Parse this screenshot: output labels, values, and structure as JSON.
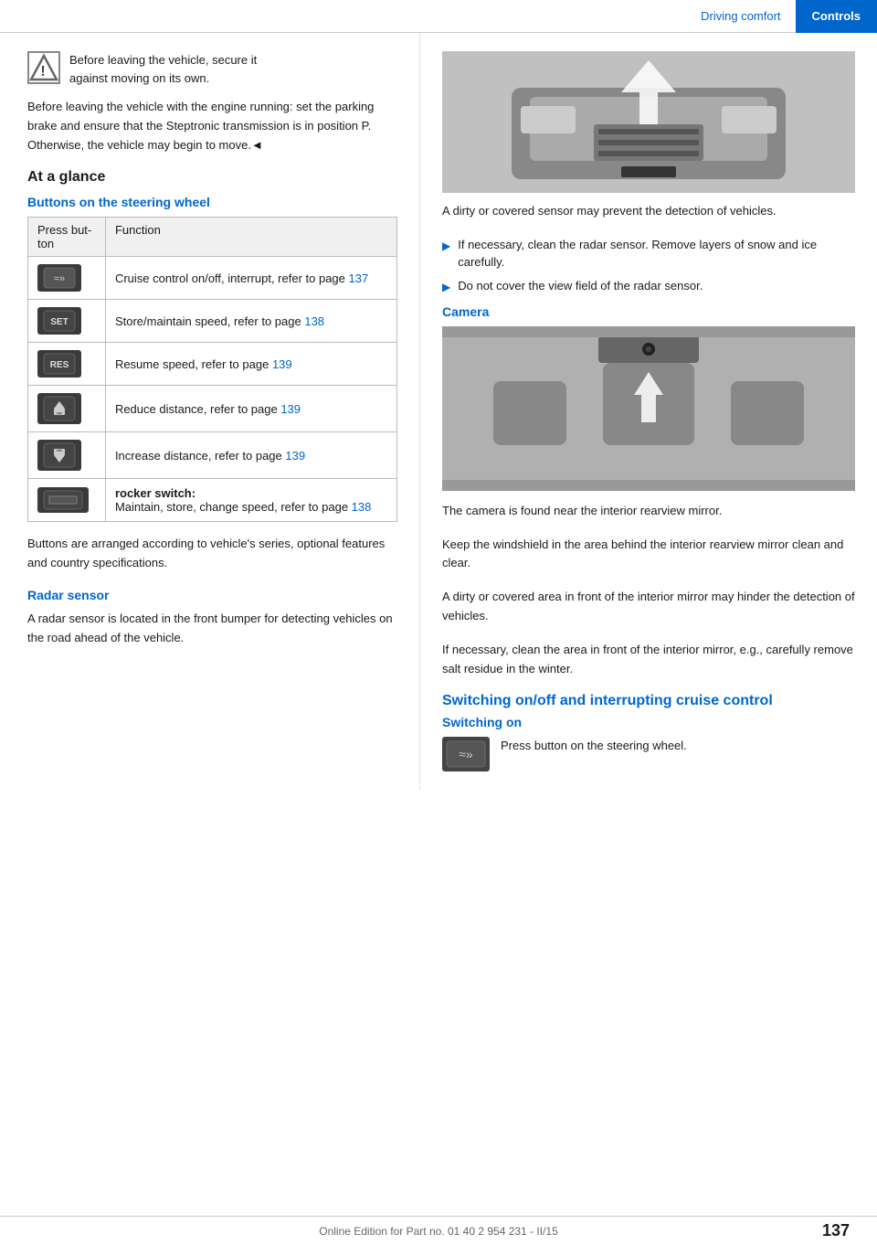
{
  "header": {
    "driving_comfort": "Driving comfort",
    "controls": "Controls"
  },
  "warning": {
    "icon": "⚠",
    "line1": "Before leaving the vehicle, secure it",
    "line2": "against moving on its own."
  },
  "body_warning": "Before leaving the vehicle with the engine running: set the parking brake and ensure that the Steptronic transmission is in position P. Otherwise, the vehicle may begin to move.◄",
  "at_a_glance": {
    "heading": "At a glance",
    "buttons_heading": "Buttons on the steering wheel",
    "table_headers": [
      "Press button",
      "Function"
    ],
    "table_rows": [
      {
        "btn_type": "cruise-icon",
        "btn_label": "≈»",
        "function": "Cruise control on/off, interrupt, refer to page ",
        "page": "137"
      },
      {
        "btn_type": "set",
        "btn_label": "SET",
        "function": "Store/maintain speed, refer to page ",
        "page": "138"
      },
      {
        "btn_type": "res",
        "btn_label": "RES",
        "function": "Resume speed, refer to page ",
        "page": "139"
      },
      {
        "btn_type": "reduce",
        "btn_label": "▲",
        "function": "Reduce distance, refer to page ",
        "page": "139"
      },
      {
        "btn_type": "increase",
        "btn_label": "▲",
        "function": "Increase distance, refer to page ",
        "page": "139"
      },
      {
        "btn_type": "rocker",
        "btn_label": "═══",
        "function_line1": "rocker switch:",
        "function_line2": "Maintain, store, change speed, refer to page ",
        "page": "138"
      }
    ],
    "note": "Buttons are arranged according to vehicle's series, optional features and country specifications."
  },
  "radar_sensor": {
    "heading": "Radar sensor",
    "body": "A radar sensor is located in the front bumper for detecting vehicles on the road ahead of the vehicle.",
    "dirty_sensor": "A dirty or covered sensor may prevent the detection of vehicles.",
    "bullets": [
      "If necessary, clean the radar sensor. Remove layers of snow and ice carefully.",
      "Do not cover the view field of the radar sensor."
    ]
  },
  "camera": {
    "heading": "Camera",
    "body1": "The camera is found near the interior rearview mirror.",
    "body2": "Keep the windshield in the area behind the interior rearview mirror clean and clear.",
    "body3": "A dirty or covered area in front of the interior mirror may hinder the detection of vehicles.",
    "body4": "If necessary, clean the area in front of the interior mirror, e.g., carefully remove salt residue in the winter."
  },
  "switching": {
    "big_heading": "Switching on/off and interrupting cruise control",
    "sub_heading": "Switching on",
    "instruction": "Press button on the steering wheel."
  },
  "footer": {
    "text": "Online Edition for Part no. 01 40 2 954 231 - II/15",
    "page": "137"
  }
}
